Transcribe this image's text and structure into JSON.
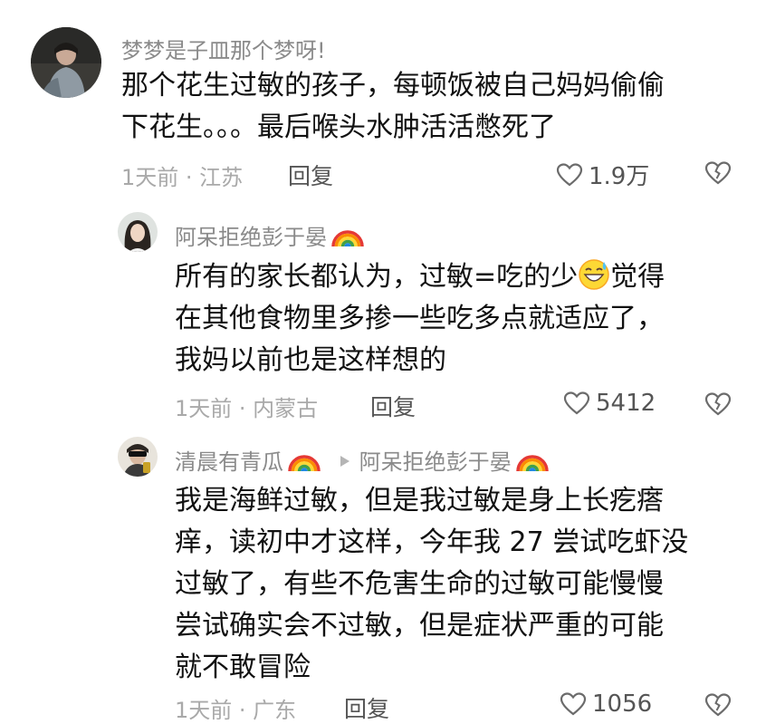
{
  "comments": [
    {
      "username": "梦梦是子皿那个梦呀!",
      "text_lines": [
        "那个花生过敏的孩子，每顿饭被自己妈妈偷偷",
        "下花生。。。最后喉头水肿活活憋死了"
      ],
      "meta": "1天前 · 江苏",
      "reply_label": "回复",
      "likes": "1.9万"
    },
    {
      "username": "阿呆拒绝彭于晏",
      "text_line1_a": "所有的家长都认为，过敏=吃的少",
      "text_line1_b": "觉得",
      "text_lines_rest": [
        "在其他食物里多掺一些吃多点就适应了，",
        "我妈以前也是这样想的"
      ],
      "meta": "1天前 · 内蒙古",
      "reply_label": "回复",
      "likes": "5412"
    },
    {
      "username": "清晨有青瓜",
      "reply_to": "阿呆拒绝彭于晏",
      "text_lines": [
        "我是海鲜过敏，但是我过敏是身上长疙瘩",
        "痒，读初中才这样，今年我 27 尝试吃虾没",
        "过敏了，有些不危害生命的过敏可能慢慢",
        "尝试确实会不过敏，但是症状严重的可能",
        "就不敢冒险"
      ],
      "meta": "1天前 · 广东",
      "reply_label": "回复",
      "likes": "1056"
    }
  ]
}
